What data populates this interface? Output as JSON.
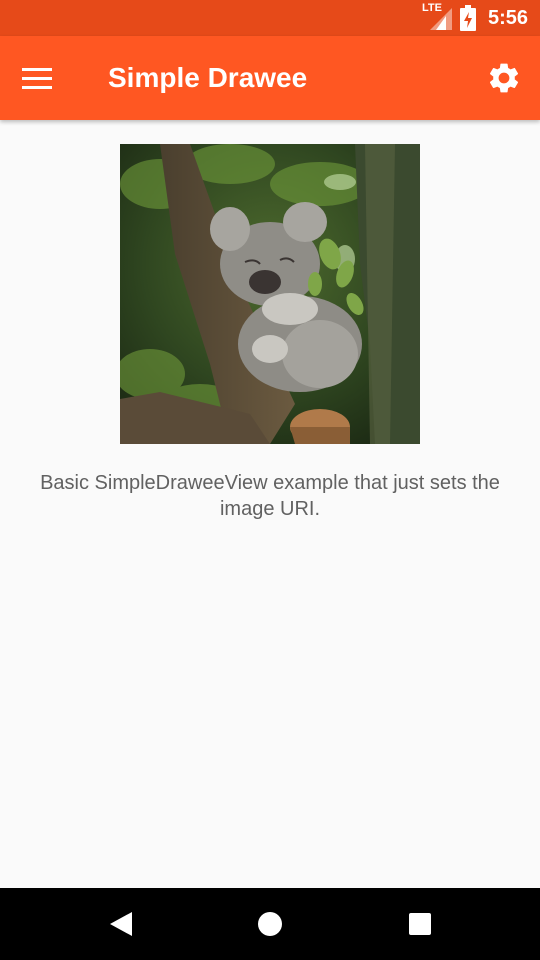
{
  "status_bar": {
    "network": "LTE",
    "time": "5:56",
    "icons": [
      "signal-icon",
      "battery-icon"
    ]
  },
  "app_bar": {
    "title": "Simple Drawee",
    "menu_icon": "hamburger-menu-icon",
    "settings_icon": "gear-icon",
    "color": "#ff5722",
    "status_color": "#e64a19"
  },
  "content": {
    "description": "Basic SimpleDraweeView example that just sets the image URI."
  },
  "nav_bar": {
    "icons": [
      "back-icon",
      "home-icon",
      "recents-icon"
    ]
  }
}
